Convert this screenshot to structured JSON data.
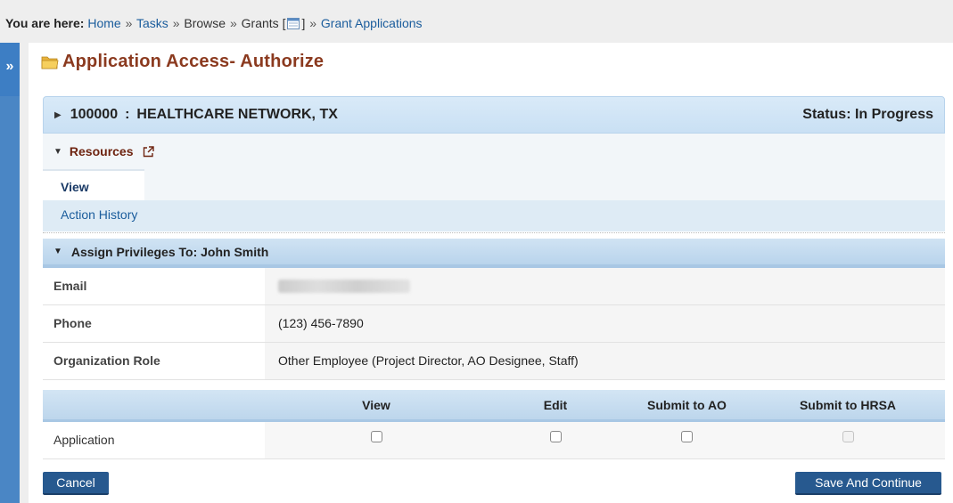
{
  "breadcrumb": {
    "label": "You are here:",
    "items": [
      "Home",
      "Tasks",
      "Browse",
      "Grants",
      "Grant Applications"
    ],
    "separator": "»",
    "bracket_open": "[",
    "bracket_close": "]"
  },
  "sidebar": {
    "toggle_glyph": "»"
  },
  "page": {
    "title": "Application Access- Authorize"
  },
  "grant": {
    "id": "100000",
    "separator": ":",
    "name": "HEALTHCARE NETWORK, TX",
    "status": "Status: In Progress"
  },
  "resources": {
    "label": "Resources",
    "tabs": [
      "View",
      "Action History"
    ]
  },
  "assign": {
    "title": "Assign Privileges To: John Smith",
    "fields": [
      {
        "label": "Email",
        "value": ""
      },
      {
        "label": "Phone",
        "value": "(123) 456-7890"
      },
      {
        "label": "Organization Role",
        "value": "Other Employee (Project Director, AO Designee, Staff)"
      }
    ]
  },
  "privileges": {
    "columns": [
      "View",
      "Edit",
      "Submit to AO",
      "Submit to HRSA"
    ],
    "rows": [
      {
        "label": "Application",
        "view": false,
        "edit": false,
        "submit_ao": false,
        "submit_hrsa": false,
        "submit_hrsa_disabled": true
      }
    ]
  },
  "actions": {
    "cancel_label": "Cancel",
    "save_label": "Save And Continue"
  },
  "colors": {
    "title": "#8b3a1f",
    "button": "#27598f",
    "link": "#1a5c9c",
    "sidebar": "#4a86c5"
  }
}
